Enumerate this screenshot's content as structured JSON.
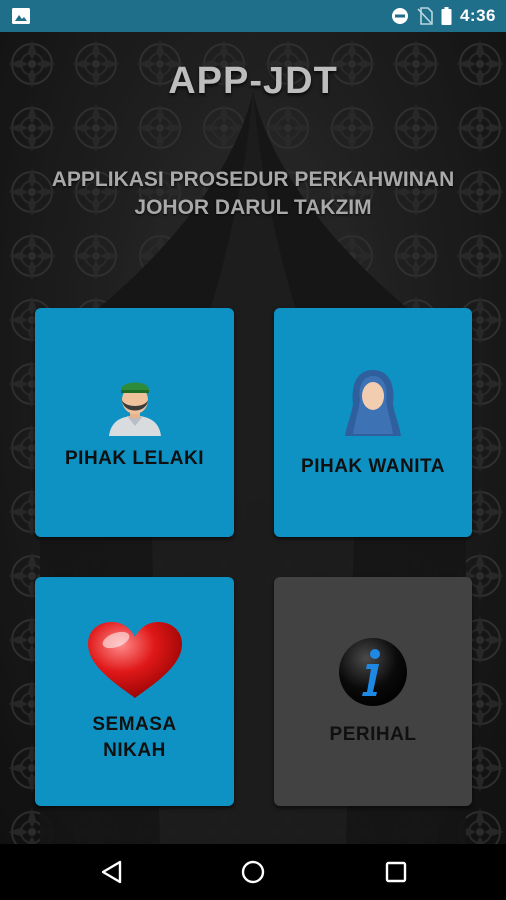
{
  "status_bar": {
    "time": "4:36",
    "icons": [
      "gallery-icon",
      "do-not-disturb-icon",
      "no-sim-icon",
      "battery-icon"
    ]
  },
  "app": {
    "title": "APP-JDT",
    "subtitle_line1": "APPLIKASI PROSEDUR PERKAHWINAN",
    "subtitle_line2": "JOHOR DARUL TAKZIM"
  },
  "tiles": {
    "lelaki": {
      "label": "PIHAK LELAKI",
      "icon": "groom-icon",
      "color": "#0e92c4"
    },
    "wanita": {
      "label": "PIHAK WANITA",
      "icon": "bride-icon",
      "color": "#0e92c4"
    },
    "nikah": {
      "label_line1": "SEMASA",
      "label_line2": "NIKAH",
      "icon": "heart-icon",
      "color": "#0e92c4"
    },
    "perihal": {
      "label": "PERIHAL",
      "icon": "info-icon",
      "color": "#424242"
    }
  },
  "nav_bar": {
    "buttons": [
      "back-icon",
      "home-icon",
      "recents-icon"
    ]
  }
}
